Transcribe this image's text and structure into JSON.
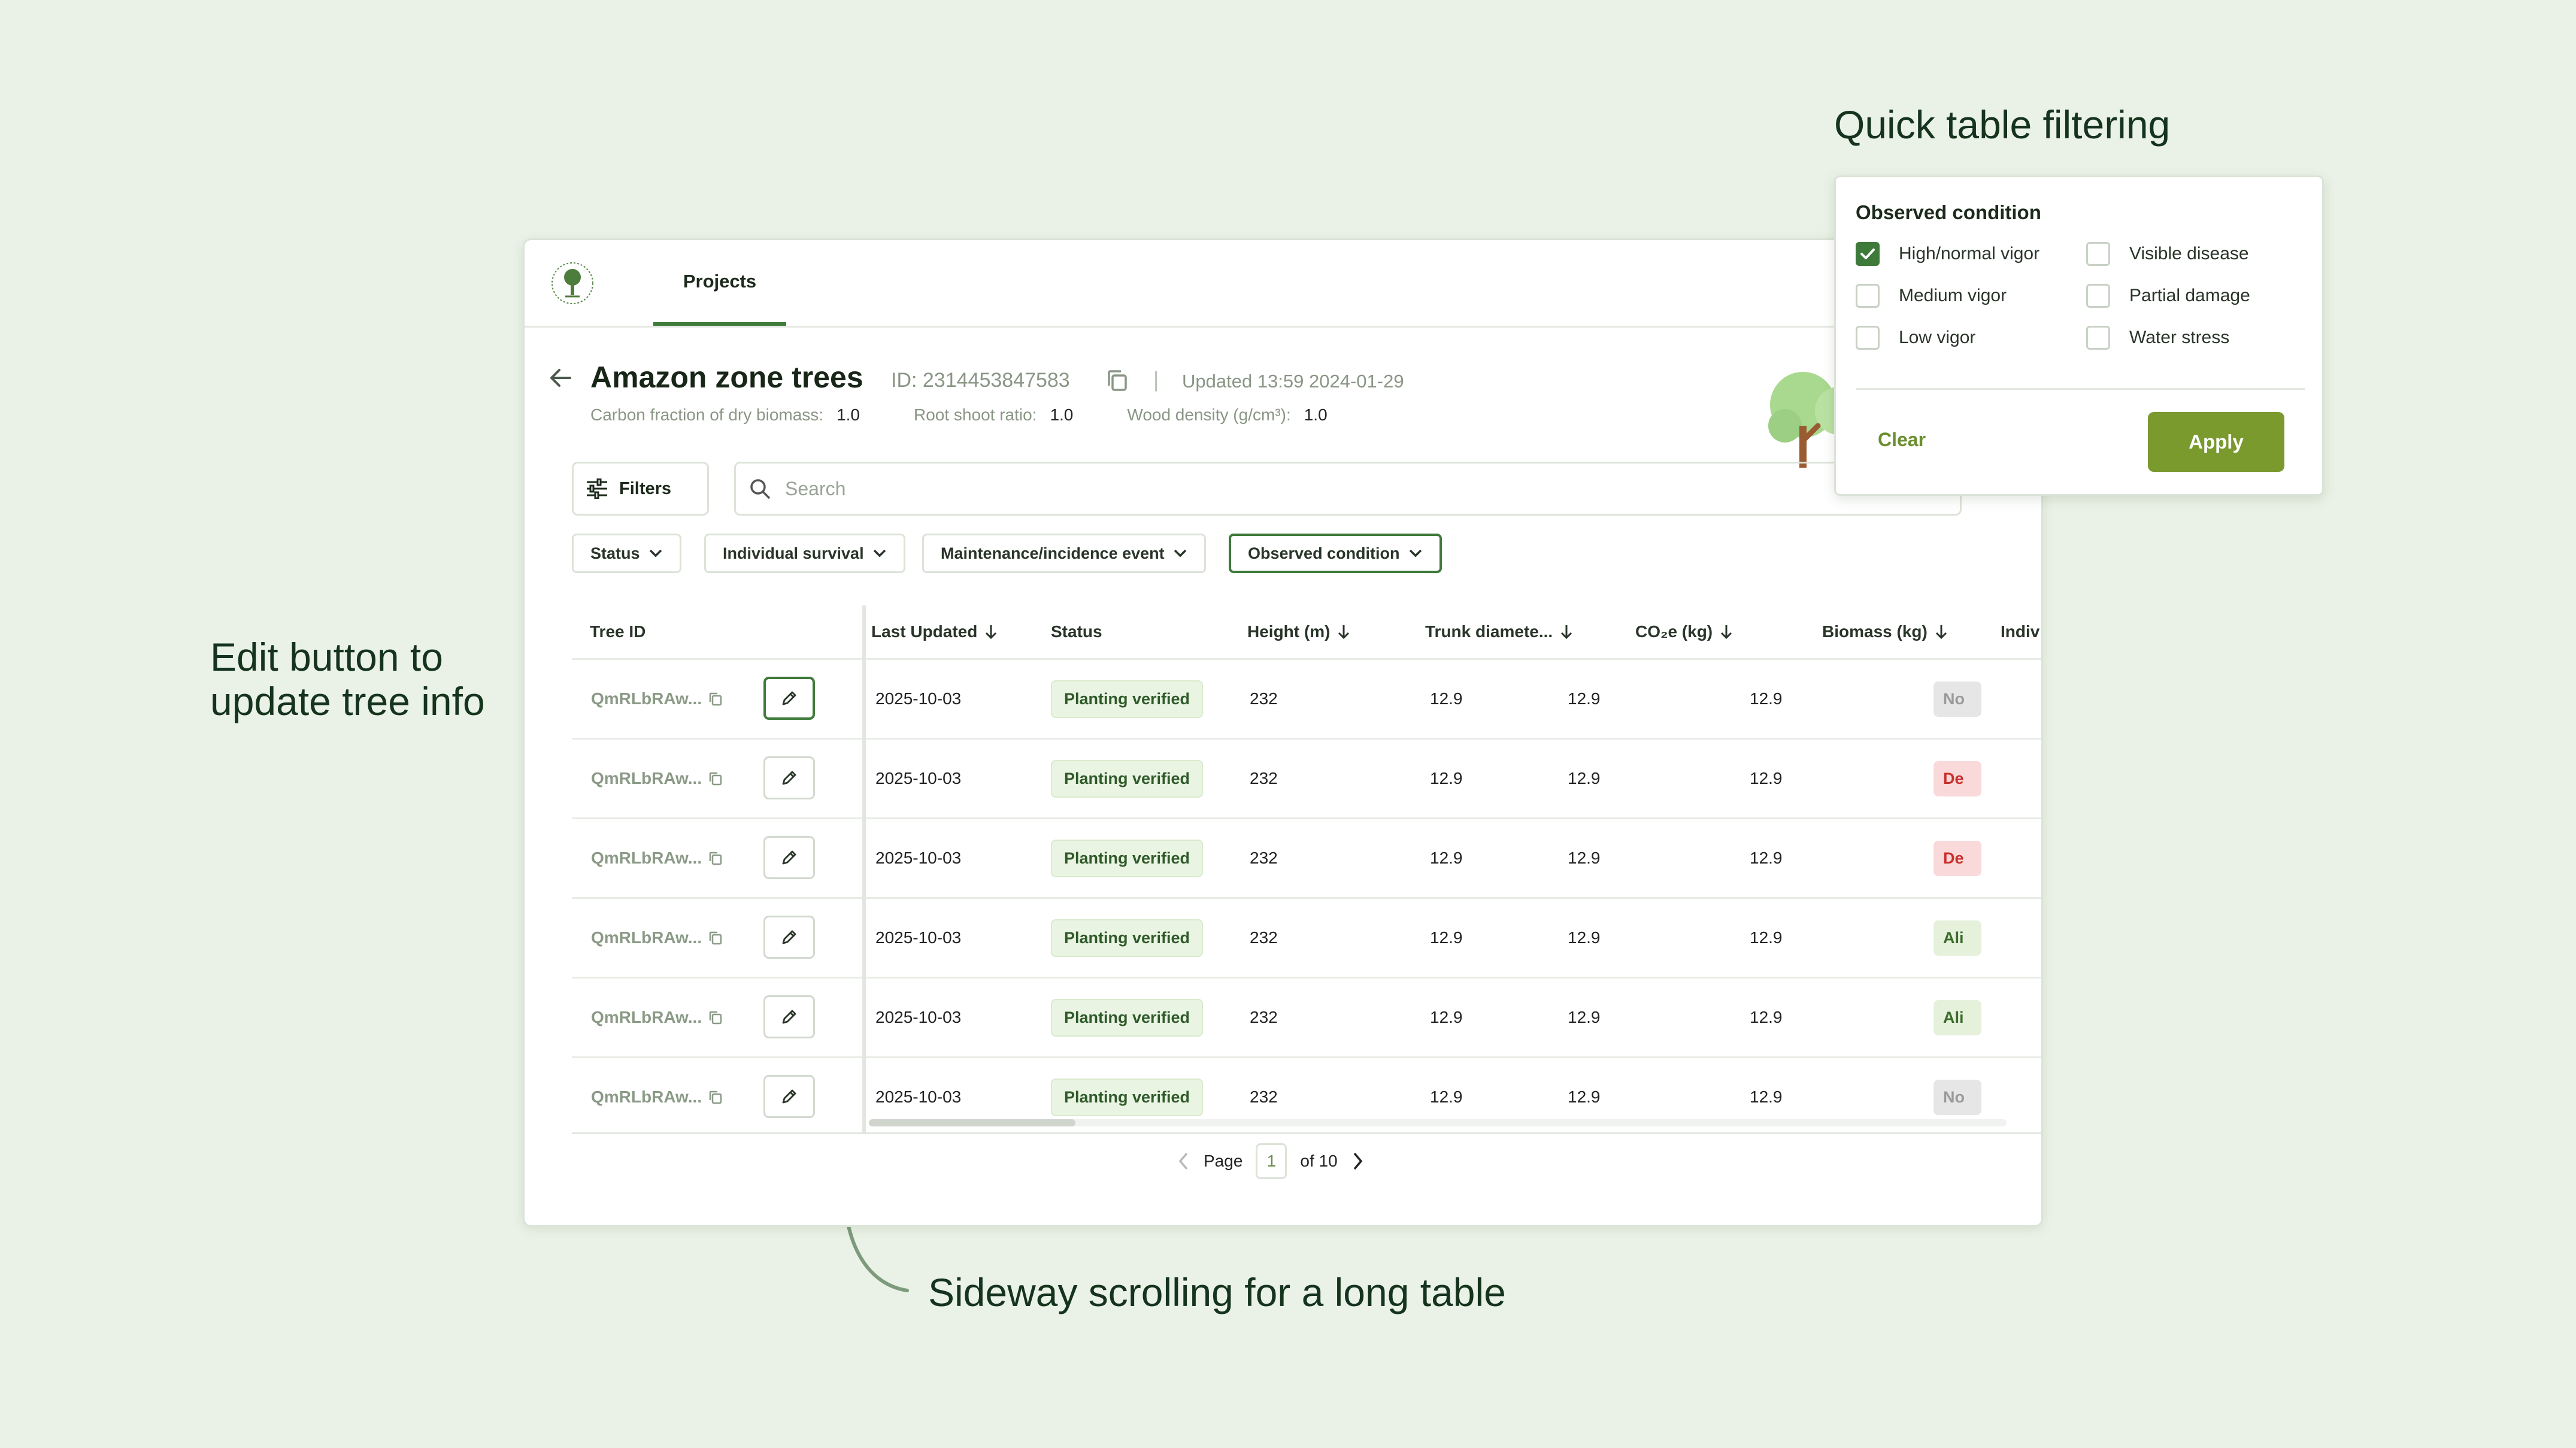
{
  "annotations": {
    "edit_line1": "Edit button to",
    "edit_line2": "update tree info",
    "filtering": "Quick table filtering",
    "scrolling": "Sideway scrolling for a long table"
  },
  "nav": {
    "projects_tab": "Projects"
  },
  "project": {
    "title": "Amazon zone trees",
    "id": "ID: 2314453847583",
    "separator": "|",
    "updated": "Updated 13:59 2024-01-29",
    "metrics": [
      {
        "label": "Carbon fraction of dry biomass:",
        "value": "1.0"
      },
      {
        "label": "Root shoot ratio:",
        "value": "1.0"
      },
      {
        "label": "Wood density (g/cm³):",
        "value": "1.0"
      }
    ]
  },
  "toolbar": {
    "filters_label": "Filters",
    "search_placeholder": "Search"
  },
  "filter_chips": [
    "Status",
    "Individual survival",
    "Maintenance/incidence event",
    "Observed condition"
  ],
  "table": {
    "columns": {
      "tree_id": "Tree ID",
      "last_updated": "Last Updated",
      "status": "Status",
      "height": "Height (m)",
      "trunk": "Trunk diamete...",
      "co2": "CO₂e (kg)",
      "biomass": "Biomass (kg)",
      "survival": "Indiv"
    },
    "rows": [
      {
        "tree_id": "QmRLbRAw...",
        "last_updated": "2025-10-03",
        "status": "Planting verified",
        "height": "232",
        "trunk": "12.9",
        "co2": "12.9",
        "biomass": "12.9",
        "survival": "No"
      },
      {
        "tree_id": "QmRLbRAw...",
        "last_updated": "2025-10-03",
        "status": "Planting verified",
        "height": "232",
        "trunk": "12.9",
        "co2": "12.9",
        "biomass": "12.9",
        "survival": "De"
      },
      {
        "tree_id": "QmRLbRAw...",
        "last_updated": "2025-10-03",
        "status": "Planting verified",
        "height": "232",
        "trunk": "12.9",
        "co2": "12.9",
        "biomass": "12.9",
        "survival": "De"
      },
      {
        "tree_id": "QmRLbRAw...",
        "last_updated": "2025-10-03",
        "status": "Planting verified",
        "height": "232",
        "trunk": "12.9",
        "co2": "12.9",
        "biomass": "12.9",
        "survival": "Ali"
      },
      {
        "tree_id": "QmRLbRAw...",
        "last_updated": "2025-10-03",
        "status": "Planting verified",
        "height": "232",
        "trunk": "12.9",
        "co2": "12.9",
        "biomass": "12.9",
        "survival": "Ali"
      },
      {
        "tree_id": "QmRLbRAw...",
        "last_updated": "2025-10-03",
        "status": "Planting verified",
        "height": "232",
        "trunk": "12.9",
        "co2": "12.9",
        "biomass": "12.9",
        "survival": "No"
      }
    ]
  },
  "pagination": {
    "page_label": "Page",
    "current": "1",
    "of_label": "of 10"
  },
  "popover": {
    "title": "Observed condition",
    "options": [
      {
        "label": "High/normal vigor",
        "checked": true
      },
      {
        "label": "Medium vigor",
        "checked": false
      },
      {
        "label": "Low vigor",
        "checked": false
      },
      {
        "label": "Visible disease",
        "checked": false
      },
      {
        "label": "Partial damage",
        "checked": false
      },
      {
        "label": "Water stress",
        "checked": false
      }
    ],
    "clear_label": "Clear",
    "apply_label": "Apply"
  },
  "colors": {
    "background": "#eaf2e7",
    "accent_green": "#3e7a3a",
    "apply_olive": "#7a9a2e",
    "survival_no_bg": "#e6e6e6",
    "survival_dead_bg": "#f9d9d9",
    "survival_alive_bg": "#e6f1dc"
  }
}
